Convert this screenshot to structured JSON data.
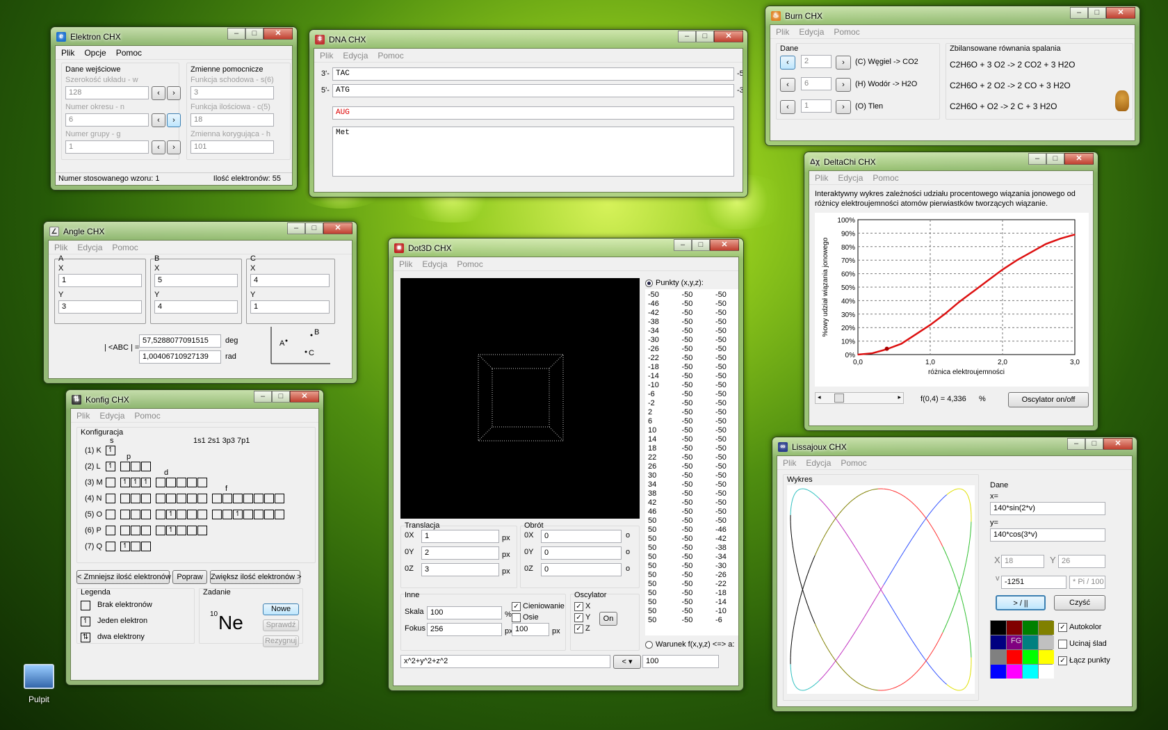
{
  "desktop": {
    "icon_label": "Pulpit"
  },
  "elektron": {
    "title": "Elektron CHX",
    "menu": [
      "Plik",
      "Opcje",
      "Pomoc"
    ],
    "left_group": "Dane wejściowe",
    "right_group": "Zmienne pomocnicze",
    "fields": [
      {
        "label": "Szerokość układu - w",
        "value": "128"
      },
      {
        "label": "Numer okresu - n",
        "value": "6"
      },
      {
        "label": "Numer grupy - g",
        "value": "1"
      }
    ],
    "aux": [
      {
        "label": "Funkcja schodowa - s(6)",
        "value": "3"
      },
      {
        "label": "Funkcja ilościowa - c(5)",
        "value": "18"
      },
      {
        "label": "Zmienna korygująca - h",
        "value": "101"
      }
    ],
    "status_left": "Numer stosowanego wzoru: 1",
    "status_right": "Ilość elektronów: 55"
  },
  "dna": {
    "title": "DNA CHX",
    "menu": [
      "Plik",
      "Edycja",
      "Pomoc"
    ],
    "strand1_prefix": "3'-",
    "strand1": "TAC",
    "strand1_suffix": "-5'",
    "strand2_prefix": "5'-",
    "strand2": "ATG",
    "strand2_suffix": "-3'",
    "rna": "AUG",
    "protein": "Met"
  },
  "burn": {
    "title": "Burn CHX",
    "menu": [
      "Plik",
      "Edycja",
      "Pomoc"
    ],
    "group": "Dane",
    "eq_title": "Zbilansowane równania spalania",
    "rows": [
      {
        "value": "2",
        "label": "(C) Węgiel -> CO2"
      },
      {
        "value": "6",
        "label": "(H) Wodór -> H2O"
      },
      {
        "value": "1",
        "label": "(O) Tlen"
      }
    ],
    "equations": [
      "C2H6O + 3 O2 -> 2 CO2 + 3 H2O",
      "C2H6O + 2 O2 -> 2 CO + 3 H2O",
      "C2H6O + O2 -> 2 C + 3 H2O"
    ]
  },
  "angle": {
    "title": "Angle CHX",
    "menu": [
      "Plik",
      "Edycja",
      "Pomoc"
    ],
    "points": [
      {
        "name": "A",
        "x": "1",
        "y": "3"
      },
      {
        "name": "B",
        "x": "5",
        "y": "4"
      },
      {
        "name": "C",
        "x": "4",
        "y": "1"
      }
    ],
    "x_label": "X",
    "y_label": "Y",
    "result_label": "| <ABC | =",
    "deg_value": "57,5288077091515",
    "deg_unit": "deg",
    "rad_value": "1,00406710927139",
    "rad_unit": "rad",
    "diag_a": "A",
    "diag_b": "B",
    "diag_c": "C"
  },
  "konfig": {
    "title": "Konfig CHX",
    "menu": [
      "Plik",
      "Edycja",
      "Pomoc"
    ],
    "group": "Konfiguracja",
    "config_text": "1s1 2s1 3p3 7p1",
    "sub_labels": [
      "s",
      "p",
      "d",
      "f"
    ],
    "shells": [
      "(1) K",
      "(2) L",
      "(3) M",
      "(4) N",
      "(5) O",
      "(6) P",
      "(7) Q"
    ],
    "btn_less": "< Zmniejsz ilość elektronów",
    "btn_fix": "Popraw",
    "btn_more": "Zwiększ ilość elektronów >",
    "legend_title": "Legenda",
    "legend": [
      "Brak elektronów",
      "Jeden elektron",
      "dwa elektrony"
    ],
    "task_title": "Zadanie",
    "task_mass": "10",
    "task_symbol": "Ne",
    "btn_new": "Nowe",
    "btn_check": "Sprawdź",
    "btn_give": "Rezygnuj"
  },
  "dot3d": {
    "title": "Dot3D CHX",
    "menu": [
      "Plik",
      "Edycja",
      "Pomoc"
    ],
    "points_label": "Punkty (x,y,z):",
    "points": [
      [
        "-50",
        "-50",
        "-50"
      ],
      [
        "-46",
        "-50",
        "-50"
      ],
      [
        "-42",
        "-50",
        "-50"
      ],
      [
        "-38",
        "-50",
        "-50"
      ],
      [
        "-34",
        "-50",
        "-50"
      ],
      [
        "-30",
        "-50",
        "-50"
      ],
      [
        "-26",
        "-50",
        "-50"
      ],
      [
        "-22",
        "-50",
        "-50"
      ],
      [
        "-18",
        "-50",
        "-50"
      ],
      [
        "-14",
        "-50",
        "-50"
      ],
      [
        "-10",
        "-50",
        "-50"
      ],
      [
        "-6",
        "-50",
        "-50"
      ],
      [
        "-2",
        "-50",
        "-50"
      ],
      [
        "2",
        "-50",
        "-50"
      ],
      [
        "6",
        "-50",
        "-50"
      ],
      [
        "10",
        "-50",
        "-50"
      ],
      [
        "14",
        "-50",
        "-50"
      ],
      [
        "18",
        "-50",
        "-50"
      ],
      [
        "22",
        "-50",
        "-50"
      ],
      [
        "26",
        "-50",
        "-50"
      ],
      [
        "30",
        "-50",
        "-50"
      ],
      [
        "34",
        "-50",
        "-50"
      ],
      [
        "38",
        "-50",
        "-50"
      ],
      [
        "42",
        "-50",
        "-50"
      ],
      [
        "46",
        "-50",
        "-50"
      ],
      [
        "50",
        "-50",
        "-50"
      ],
      [
        "50",
        "-50",
        "-46"
      ],
      [
        "50",
        "-50",
        "-42"
      ],
      [
        "50",
        "-50",
        "-38"
      ],
      [
        "50",
        "-50",
        "-34"
      ],
      [
        "50",
        "-50",
        "-30"
      ],
      [
        "50",
        "-50",
        "-26"
      ],
      [
        "50",
        "-50",
        "-22"
      ],
      [
        "50",
        "-50",
        "-18"
      ],
      [
        "50",
        "-50",
        "-14"
      ],
      [
        "50",
        "-50",
        "-10"
      ],
      [
        "50",
        "-50",
        "-6"
      ]
    ],
    "translation_title": "Translacja",
    "rotation_title": "Obrót",
    "ox": "0X",
    "oy": "0Y",
    "oz": "0Z",
    "tx": "1",
    "ty": "2",
    "tz": "3",
    "rx": "0",
    "ry": "0",
    "rz": "0",
    "unit_px": "px",
    "unit_o": "o",
    "other_title": "Inne",
    "scale_label": "Skala",
    "scale": "100",
    "scale_unit": "%",
    "focus_label": "Fokus",
    "focus": "256",
    "focus2": "100",
    "shading": "Cieniowanie",
    "axes": "Osie",
    "osc_title": "Oscylator",
    "osc_x": "X",
    "osc_y": "Y",
    "osc_z": "Z",
    "osc_btn": "On",
    "condition_label": "Warunek f(x,y,z) <=> a:",
    "formula": "x^2+y^2+z^2",
    "op": "<",
    "a_value": "100"
  },
  "deltachi": {
    "title": "DeltaChi CHX",
    "menu": [
      "Plik",
      "Edycja",
      "Pomoc"
    ],
    "description": "Interaktywny wykres zależności udziału procentowego wiązania jonowego od różnicy elektroujemności atomów pierwiastków tworzących wiązanie.",
    "readout": "f(0,4) = 4,336",
    "readout_unit": "%",
    "osc_button": "Oscylator on/off",
    "slider_value": 0.13
  },
  "lissajoux": {
    "title": "Lissajoux CHX",
    "menu": [
      "Plik",
      "Edycja",
      "Pomoc"
    ],
    "plot_label": "Wykres",
    "data_title": "Dane",
    "x_label": "x=",
    "x_expr": "140*sin(2*v)",
    "y_label": "y=",
    "y_expr": "140*cos(3*v)",
    "X_lbl": "X",
    "X_val": "18",
    "Y_lbl": "Y",
    "Y_val": "26",
    "v_lbl": "v",
    "v_val": "-1251",
    "v_unit": "* Pi / 100",
    "play_btn": "> / ||",
    "clear_btn": "Czyść",
    "fg_label": "FG",
    "autokolor": "Autokolor",
    "ucinaj": "Ucinaj ślad",
    "lacz": "Łącz punkty",
    "palette": [
      "#000000",
      "#800000",
      "#008000",
      "#808000",
      "#000080",
      "#800080",
      "#008080",
      "#c0c0c0",
      "#808080",
      "#ff0000",
      "#00ff00",
      "#ffff00",
      "#0000ff",
      "#ff00ff",
      "#00ffff",
      "#ffffff"
    ]
  },
  "chart_data": {
    "type": "line",
    "title": "",
    "xlabel": "różnica elektroujemności",
    "ylabel": "%owy udział wiązania jonowego",
    "xlim": [
      0,
      3
    ],
    "ylim": [
      0,
      100
    ],
    "xticks": [
      "0,0",
      "1,0",
      "2,0",
      "3,0"
    ],
    "yticks": [
      "0%",
      "10%",
      "20%",
      "30%",
      "40%",
      "50%",
      "60%",
      "70%",
      "80%",
      "90%",
      "100%"
    ],
    "grid": true,
    "x": [
      0,
      0.2,
      0.4,
      0.6,
      0.8,
      1.0,
      1.2,
      1.4,
      1.6,
      1.8,
      2.0,
      2.2,
      2.4,
      2.6,
      2.8,
      3.0
    ],
    "series": [
      {
        "values": [
          0,
          1,
          4,
          8,
          15,
          22,
          30,
          39,
          47,
          55,
          63,
          70,
          76,
          82,
          86,
          89
        ]
      }
    ],
    "marker": {
      "x": 0.4,
      "y": 4.336
    }
  }
}
